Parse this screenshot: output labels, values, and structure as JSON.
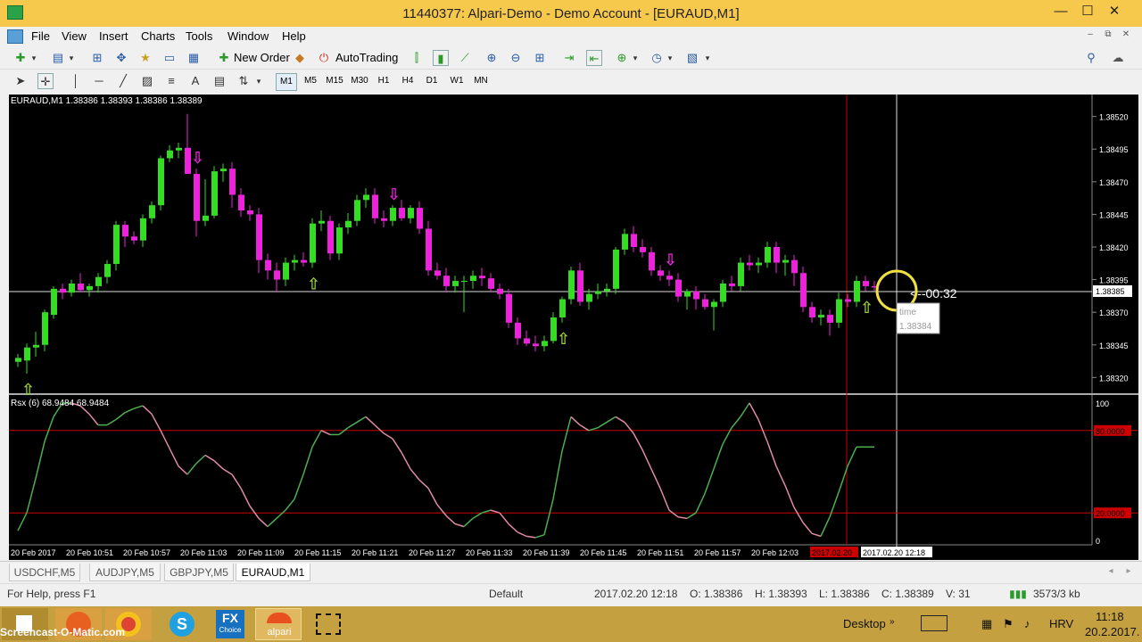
{
  "window": {
    "title": "11440377: Alpari-Demo - Demo Account - [EURAUD,M1]",
    "minimize": "—",
    "maximize": "☐",
    "close": "✕"
  },
  "menu": {
    "items": [
      "File",
      "View",
      "Insert",
      "Charts",
      "Tools",
      "Window",
      "Help"
    ],
    "mdi_minimize": "‒",
    "mdi_restore": "⧉",
    "mdi_close": "✕"
  },
  "toolbar": {
    "new_order": "New Order",
    "autotrading": "AutoTrading",
    "text_tool": "A",
    "timeframes": [
      "M1",
      "M5",
      "M15",
      "M30",
      "H1",
      "H4",
      "D1",
      "W1",
      "MN"
    ],
    "active_timeframe": "M1"
  },
  "chart": {
    "symbol_header": "EURAUD,M1  1.38386 1.38393 1.38386 1.38389",
    "price_labels": [
      "1.38520",
      "1.38495",
      "1.38470",
      "1.38445",
      "1.38420",
      "1.38395",
      "1.38385",
      "1.38370",
      "1.38345",
      "1.38320"
    ],
    "current_price_label": "1.38385",
    "timer": "<--00:32",
    "tooltip_label": "time",
    "tooltip_value": "1.38384",
    "time_labels": [
      "20 Feb 2017",
      "20 Feb 10:51",
      "20 Feb 10:57",
      "20 Feb 11:03",
      "20 Feb 11:09",
      "20 Feb 11:15",
      "20 Feb 11:21",
      "20 Feb 11:27",
      "20 Feb 11:33",
      "20 Feb 11:39",
      "20 Feb 11:45",
      "20 Feb 11:51",
      "20 Feb 11:57",
      "20 Feb 12:03"
    ],
    "highlight_time_red": "2017.02.20",
    "highlight_time_white": "2017.02.20 12:18",
    "colors": {
      "bull": "#33dd22",
      "bear": "#ee22dd",
      "arrow_up": "#9acd32",
      "background": "#000000",
      "level_line": "#cc0000"
    },
    "chart_data": {
      "type": "candlestick",
      "candles": [
        {
          "o": 1.38332,
          "h": 1.38338,
          "l": 1.38328,
          "c": 1.38335
        },
        {
          "o": 1.38333,
          "h": 1.38346,
          "l": 1.38323,
          "c": 1.38343
        },
        {
          "o": 1.38343,
          "h": 1.38355,
          "l": 1.38336,
          "c": 1.38345
        },
        {
          "o": 1.38345,
          "h": 1.38372,
          "l": 1.3834,
          "c": 1.3837
        },
        {
          "o": 1.38368,
          "h": 1.3839,
          "l": 1.38365,
          "c": 1.38388
        },
        {
          "o": 1.38388,
          "h": 1.38392,
          "l": 1.3838,
          "c": 1.38385
        },
        {
          "o": 1.38385,
          "h": 1.38395,
          "l": 1.38382,
          "c": 1.38392
        },
        {
          "o": 1.38392,
          "h": 1.384,
          "l": 1.38385,
          "c": 1.38387
        },
        {
          "o": 1.38387,
          "h": 1.38392,
          "l": 1.38382,
          "c": 1.3839
        },
        {
          "o": 1.3839,
          "h": 1.384,
          "l": 1.38385,
          "c": 1.38397
        },
        {
          "o": 1.38397,
          "h": 1.3841,
          "l": 1.38392,
          "c": 1.38407
        },
        {
          "o": 1.38407,
          "h": 1.3844,
          "l": 1.38402,
          "c": 1.38437
        },
        {
          "o": 1.38437,
          "h": 1.3844,
          "l": 1.3842,
          "c": 1.38428
        },
        {
          "o": 1.38428,
          "h": 1.38432,
          "l": 1.38422,
          "c": 1.38425
        },
        {
          "o": 1.38425,
          "h": 1.38445,
          "l": 1.3842,
          "c": 1.38442
        },
        {
          "o": 1.38442,
          "h": 1.38455,
          "l": 1.38438,
          "c": 1.38452
        },
        {
          "o": 1.38452,
          "h": 1.3849,
          "l": 1.38448,
          "c": 1.38488
        },
        {
          "o": 1.38488,
          "h": 1.38498,
          "l": 1.38485,
          "c": 1.38494
        },
        {
          "o": 1.38494,
          "h": 1.385,
          "l": 1.38488,
          "c": 1.38496
        },
        {
          "o": 1.38496,
          "h": 1.38522,
          "l": 1.3849,
          "c": 1.38476
        },
        {
          "o": 1.38476,
          "h": 1.3848,
          "l": 1.38428,
          "c": 1.3844
        },
        {
          "o": 1.3844,
          "h": 1.38472,
          "l": 1.38436,
          "c": 1.38444
        },
        {
          "o": 1.38444,
          "h": 1.38482,
          "l": 1.38442,
          "c": 1.38478
        },
        {
          "o": 1.38478,
          "h": 1.38484,
          "l": 1.3847,
          "c": 1.3848
        },
        {
          "o": 1.3848,
          "h": 1.38485,
          "l": 1.3845,
          "c": 1.3846
        },
        {
          "o": 1.3846,
          "h": 1.38465,
          "l": 1.38443,
          "c": 1.38448
        },
        {
          "o": 1.38448,
          "h": 1.38452,
          "l": 1.3844,
          "c": 1.38445
        },
        {
          "o": 1.38445,
          "h": 1.3845,
          "l": 1.384,
          "c": 1.3841
        },
        {
          "o": 1.3841,
          "h": 1.38415,
          "l": 1.38395,
          "c": 1.38402
        },
        {
          "o": 1.38402,
          "h": 1.38408,
          "l": 1.38385,
          "c": 1.38395
        },
        {
          "o": 1.38395,
          "h": 1.38412,
          "l": 1.3839,
          "c": 1.38408
        },
        {
          "o": 1.38408,
          "h": 1.38414,
          "l": 1.38402,
          "c": 1.3841
        },
        {
          "o": 1.3841,
          "h": 1.38416,
          "l": 1.38405,
          "c": 1.38408
        },
        {
          "o": 1.38408,
          "h": 1.38442,
          "l": 1.38404,
          "c": 1.38438
        },
        {
          "o": 1.38438,
          "h": 1.38448,
          "l": 1.38432,
          "c": 1.3844
        },
        {
          "o": 1.3844,
          "h": 1.38444,
          "l": 1.3841,
          "c": 1.38415
        },
        {
          "o": 1.38415,
          "h": 1.38438,
          "l": 1.3841,
          "c": 1.38435
        },
        {
          "o": 1.38435,
          "h": 1.38446,
          "l": 1.3843,
          "c": 1.3844
        },
        {
          "o": 1.3844,
          "h": 1.3846,
          "l": 1.38436,
          "c": 1.38456
        },
        {
          "o": 1.38456,
          "h": 1.38465,
          "l": 1.3845,
          "c": 1.3846
        },
        {
          "o": 1.3846,
          "h": 1.38465,
          "l": 1.38438,
          "c": 1.38442
        },
        {
          "o": 1.38442,
          "h": 1.38448,
          "l": 1.38435,
          "c": 1.3844
        },
        {
          "o": 1.3844,
          "h": 1.38452,
          "l": 1.38436,
          "c": 1.3845
        },
        {
          "o": 1.3845,
          "h": 1.38456,
          "l": 1.3844,
          "c": 1.38442
        },
        {
          "o": 1.38442,
          "h": 1.38452,
          "l": 1.38438,
          "c": 1.3845
        },
        {
          "o": 1.3845,
          "h": 1.38455,
          "l": 1.3843,
          "c": 1.38434
        },
        {
          "o": 1.38434,
          "h": 1.3844,
          "l": 1.38398,
          "c": 1.38402
        },
        {
          "o": 1.38402,
          "h": 1.38408,
          "l": 1.38395,
          "c": 1.38398
        },
        {
          "o": 1.38398,
          "h": 1.38404,
          "l": 1.38385,
          "c": 1.3839
        },
        {
          "o": 1.3839,
          "h": 1.38398,
          "l": 1.38385,
          "c": 1.38394
        },
        {
          "o": 1.38394,
          "h": 1.38398,
          "l": 1.3837,
          "c": 1.38394
        },
        {
          "o": 1.38394,
          "h": 1.38402,
          "l": 1.38388,
          "c": 1.38398
        },
        {
          "o": 1.38398,
          "h": 1.38404,
          "l": 1.3839,
          "c": 1.38396
        },
        {
          "o": 1.38396,
          "h": 1.384,
          "l": 1.38385,
          "c": 1.38388
        },
        {
          "o": 1.38388,
          "h": 1.38392,
          "l": 1.3838,
          "c": 1.38384
        },
        {
          "o": 1.38384,
          "h": 1.38388,
          "l": 1.38358,
          "c": 1.38362
        },
        {
          "o": 1.38362,
          "h": 1.38366,
          "l": 1.38345,
          "c": 1.3835
        },
        {
          "o": 1.3835,
          "h": 1.38356,
          "l": 1.38344,
          "c": 1.38346
        },
        {
          "o": 1.38346,
          "h": 1.38352,
          "l": 1.3834,
          "c": 1.38344
        },
        {
          "o": 1.38344,
          "h": 1.38352,
          "l": 1.3834,
          "c": 1.38348
        },
        {
          "o": 1.38348,
          "h": 1.3837,
          "l": 1.38346,
          "c": 1.38366
        },
        {
          "o": 1.38366,
          "h": 1.38382,
          "l": 1.38362,
          "c": 1.3838
        },
        {
          "o": 1.3838,
          "h": 1.38405,
          "l": 1.38376,
          "c": 1.38402
        },
        {
          "o": 1.38402,
          "h": 1.38408,
          "l": 1.38375,
          "c": 1.38378
        },
        {
          "o": 1.38378,
          "h": 1.38388,
          "l": 1.38372,
          "c": 1.38384
        },
        {
          "o": 1.38384,
          "h": 1.38392,
          "l": 1.3838,
          "c": 1.38386
        },
        {
          "o": 1.38386,
          "h": 1.38392,
          "l": 1.38382,
          "c": 1.38388
        },
        {
          "o": 1.38388,
          "h": 1.3842,
          "l": 1.38384,
          "c": 1.38418
        },
        {
          "o": 1.38418,
          "h": 1.38434,
          "l": 1.38414,
          "c": 1.3843
        },
        {
          "o": 1.3843,
          "h": 1.38436,
          "l": 1.38416,
          "c": 1.3842
        },
        {
          "o": 1.3842,
          "h": 1.38426,
          "l": 1.38412,
          "c": 1.38416
        },
        {
          "o": 1.38416,
          "h": 1.3842,
          "l": 1.38398,
          "c": 1.38402
        },
        {
          "o": 1.38402,
          "h": 1.38406,
          "l": 1.38394,
          "c": 1.38398
        },
        {
          "o": 1.38398,
          "h": 1.38402,
          "l": 1.3839,
          "c": 1.38395
        },
        {
          "o": 1.38395,
          "h": 1.384,
          "l": 1.38378,
          "c": 1.38382
        },
        {
          "o": 1.38382,
          "h": 1.38388,
          "l": 1.38372,
          "c": 1.38386
        },
        {
          "o": 1.38386,
          "h": 1.3839,
          "l": 1.38372,
          "c": 1.3838
        },
        {
          "o": 1.3838,
          "h": 1.38384,
          "l": 1.38372,
          "c": 1.38374
        },
        {
          "o": 1.38374,
          "h": 1.3838,
          "l": 1.38356,
          "c": 1.38378
        },
        {
          "o": 1.38378,
          "h": 1.38395,
          "l": 1.38374,
          "c": 1.38392
        },
        {
          "o": 1.38392,
          "h": 1.38398,
          "l": 1.38386,
          "c": 1.3839
        },
        {
          "o": 1.3839,
          "h": 1.38412,
          "l": 1.38386,
          "c": 1.38408
        },
        {
          "o": 1.38408,
          "h": 1.38414,
          "l": 1.38402,
          "c": 1.38406
        },
        {
          "o": 1.38406,
          "h": 1.38412,
          "l": 1.384,
          "c": 1.38408
        },
        {
          "o": 1.38408,
          "h": 1.38424,
          "l": 1.38404,
          "c": 1.3842
        },
        {
          "o": 1.3842,
          "h": 1.38424,
          "l": 1.384,
          "c": 1.38408
        },
        {
          "o": 1.38408,
          "h": 1.38414,
          "l": 1.38398,
          "c": 1.3841
        },
        {
          "o": 1.3841,
          "h": 1.38414,
          "l": 1.3839,
          "c": 1.384
        },
        {
          "o": 1.384,
          "h": 1.38405,
          "l": 1.3837,
          "c": 1.38374
        },
        {
          "o": 1.38374,
          "h": 1.38378,
          "l": 1.38362,
          "c": 1.38366
        },
        {
          "o": 1.38366,
          "h": 1.38372,
          "l": 1.3836,
          "c": 1.38368
        },
        {
          "o": 1.38368,
          "h": 1.38372,
          "l": 1.38352,
          "c": 1.38362
        },
        {
          "o": 1.38362,
          "h": 1.38385,
          "l": 1.38358,
          "c": 1.3838
        },
        {
          "o": 1.3838,
          "h": 1.38384,
          "l": 1.38374,
          "c": 1.38378
        },
        {
          "o": 1.38378,
          "h": 1.38398,
          "l": 1.38374,
          "c": 1.38394
        },
        {
          "o": 1.38394,
          "h": 1.38398,
          "l": 1.38386,
          "c": 1.3839
        },
        {
          "o": 1.3839,
          "h": 1.38394,
          "l": 1.38386,
          "c": 1.38389
        }
      ],
      "arrows": [
        {
          "i": 1,
          "dir": "up"
        },
        {
          "i": 20,
          "dir": "down"
        },
        {
          "i": 33,
          "dir": "up"
        },
        {
          "i": 42,
          "dir": "down"
        },
        {
          "i": 61,
          "dir": "up"
        },
        {
          "i": 73,
          "dir": "down"
        },
        {
          "i": 95,
          "dir": "up"
        }
      ],
      "ylim": [
        1.3831,
        1.3853
      ],
      "indicator": {
        "name": "Rsx (6) 68.9484 68.9484",
        "levels": [
          80,
          20
        ],
        "level_labels": [
          "80.0000",
          "20.0000"
        ],
        "scale_labels": [
          "100",
          "0"
        ],
        "ylim": [
          0,
          100
        ],
        "values": [
          7,
          20,
          45,
          72,
          90,
          100,
          100,
          98,
          92,
          84,
          84,
          88,
          93,
          96,
          98,
          92,
          80,
          67,
          54,
          48,
          56,
          62,
          58,
          52,
          48,
          38,
          25,
          16,
          10,
          16,
          22,
          30,
          48,
          68,
          80,
          77,
          77,
          82,
          86,
          90,
          84,
          78,
          74,
          64,
          52,
          44,
          38,
          26,
          18,
          12,
          10,
          16,
          20,
          22,
          20,
          12,
          6,
          3,
          2,
          4,
          30,
          65,
          90,
          84,
          80,
          82,
          86,
          90,
          86,
          78,
          66,
          52,
          38,
          22,
          17,
          16,
          20,
          34,
          52,
          70,
          82,
          90,
          100,
          88,
          72,
          54,
          40,
          24,
          13,
          5,
          3,
          17,
          35,
          54,
          68,
          68,
          68
        ]
      }
    }
  },
  "tabs": [
    "USDCHF,M5",
    "AUDJPY,M5",
    "GBPJPY,M5",
    "EURAUD,M1"
  ],
  "active_tab": "EURAUD,M1",
  "status": {
    "help": "For Help, press F1",
    "profile": "Default",
    "datetime": "2017.02.20 12:18",
    "open": "O: 1.38386",
    "high": "H: 1.38393",
    "low": "L: 1.38386",
    "close": "C: 1.38389",
    "volume": "V: 31",
    "traffic": "3573/3 kb"
  },
  "taskbar": {
    "screencast_label": "Screencast-O-Matic.com",
    "fxchoice_label": "FX",
    "fxchoice_sub": "Choice",
    "alpari_label": "alpari",
    "desktop": "Desktop",
    "language": "HRV",
    "time": "11:18",
    "date": "20.2.2017."
  }
}
